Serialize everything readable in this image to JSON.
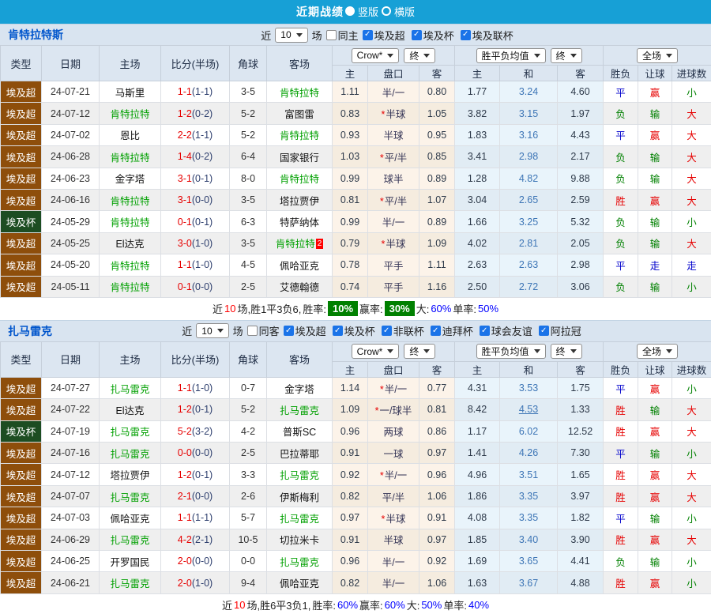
{
  "colors": {
    "accent_blue": "#17a0d6",
    "type_brown": "#8e4e0b",
    "cup_green": "#1d4d22",
    "team_green": "#00a000",
    "win_red": "#e60000",
    "lose_green": "#008000",
    "draw_blue": "#0000cc",
    "badge_green": "#008000",
    "summary_blue": "#0000ff",
    "orange": "#e06c00"
  },
  "topbar": {
    "title": "近期战绩",
    "options": [
      {
        "label": "竖版",
        "selected": true
      },
      {
        "label": "横版",
        "selected": false
      }
    ]
  },
  "table_header": {
    "cols": [
      "类型",
      "日期",
      "主场",
      "比分(半场)",
      "角球",
      "客场"
    ],
    "sub": [
      "主",
      "盘口",
      "客",
      "主",
      "和",
      "客",
      "胜负",
      "让球",
      "进球数"
    ],
    "selects": {
      "crow": "Crow*",
      "end1": "终",
      "avg": "胜平负均值",
      "end2": "终",
      "scope": "全场"
    }
  },
  "sections": [
    {
      "team": "肯特拉特斯",
      "controls": {
        "near": "近",
        "count": "10",
        "unit": "场",
        "same": {
          "label": "同主",
          "checked": false
        },
        "leagues": [
          {
            "label": "埃及超",
            "checked": true
          },
          {
            "label": "埃及杯",
            "checked": true
          },
          {
            "label": "埃及联杯",
            "checked": true
          }
        ]
      },
      "rows": [
        {
          "type": "埃及超",
          "cup": false,
          "date": "24-07-21",
          "home": "马斯里",
          "home_green": false,
          "score": "1-1",
          "half": "(1-1)",
          "corner": "3-5",
          "away": "肯特拉特",
          "away_green": true,
          "away_badge": "",
          "odds_home": "1.11",
          "handicap": "半/一",
          "handicap_star": false,
          "odds_away": "0.80",
          "avg_home": "1.77",
          "avg_draw": "3.24",
          "avg_draw_orange": false,
          "avg_away": "4.60",
          "result": "平",
          "result_color": "blue",
          "handicap_result": "赢",
          "handicap_result_color": "red",
          "goals": "小",
          "goals_color": "green"
        },
        {
          "type": "埃及超",
          "cup": false,
          "date": "24-07-12",
          "home": "肯特拉特",
          "home_green": true,
          "score": "1-2",
          "half": "(0-2)",
          "corner": "5-2",
          "away": "富图雷",
          "away_green": false,
          "away_badge": "",
          "odds_home": "0.83",
          "handicap": "半球",
          "handicap_star": true,
          "odds_away": "1.05",
          "avg_home": "3.82",
          "avg_draw": "3.15",
          "avg_draw_orange": false,
          "avg_away": "1.97",
          "result": "负",
          "result_color": "green",
          "handicap_result": "输",
          "handicap_result_color": "green",
          "goals": "大",
          "goals_color": "red"
        },
        {
          "type": "埃及超",
          "cup": false,
          "date": "24-07-02",
          "home": "恩比",
          "home_green": false,
          "score": "2-2",
          "half": "(1-1)",
          "corner": "5-2",
          "away": "肯特拉特",
          "away_green": true,
          "away_badge": "",
          "odds_home": "0.93",
          "handicap": "半球",
          "handicap_star": false,
          "odds_away": "0.95",
          "avg_home": "1.83",
          "avg_draw": "3.16",
          "avg_draw_orange": false,
          "avg_away": "4.43",
          "result": "平",
          "result_color": "blue",
          "handicap_result": "赢",
          "handicap_result_color": "red",
          "goals": "大",
          "goals_color": "red"
        },
        {
          "type": "埃及超",
          "cup": false,
          "date": "24-06-28",
          "home": "肯特拉特",
          "home_green": true,
          "score": "1-4",
          "half": "(0-2)",
          "corner": "6-4",
          "away": "国家银行",
          "away_green": false,
          "away_badge": "",
          "odds_home": "1.03",
          "handicap": "平/半",
          "handicap_star": true,
          "odds_away": "0.85",
          "avg_home": "3.41",
          "avg_draw": "2.98",
          "avg_draw_orange": false,
          "avg_away": "2.17",
          "result": "负",
          "result_color": "green",
          "handicap_result": "输",
          "handicap_result_color": "green",
          "goals": "大",
          "goals_color": "red"
        },
        {
          "type": "埃及超",
          "cup": false,
          "date": "24-06-23",
          "home": "金字塔",
          "home_green": false,
          "score": "3-1",
          "half": "(0-1)",
          "corner": "8-0",
          "away": "肯特拉特",
          "away_green": true,
          "away_badge": "",
          "odds_home": "0.99",
          "handicap": "球半",
          "handicap_star": false,
          "odds_away": "0.89",
          "avg_home": "1.28",
          "avg_draw": "4.82",
          "avg_draw_orange": false,
          "avg_away": "9.88",
          "result": "负",
          "result_color": "green",
          "handicap_result": "输",
          "handicap_result_color": "green",
          "goals": "大",
          "goals_color": "red"
        },
        {
          "type": "埃及超",
          "cup": false,
          "date": "24-06-16",
          "home": "肯特拉特",
          "home_green": true,
          "score": "3-1",
          "half": "(0-0)",
          "corner": "3-5",
          "away": "塔拉贾伊",
          "away_green": false,
          "away_badge": "",
          "odds_home": "0.81",
          "handicap": "平/半",
          "handicap_star": true,
          "odds_away": "1.07",
          "avg_home": "3.04",
          "avg_draw": "2.65",
          "avg_draw_orange": false,
          "avg_away": "2.59",
          "result": "胜",
          "result_color": "red",
          "handicap_result": "赢",
          "handicap_result_color": "red",
          "goals": "大",
          "goals_color": "red"
        },
        {
          "type": "埃及杯",
          "cup": true,
          "date": "24-05-29",
          "home": "肯特拉特",
          "home_green": true,
          "score": "0-1",
          "half": "(0-1)",
          "corner": "6-3",
          "away": "特萨纳体",
          "away_green": false,
          "away_badge": "",
          "odds_home": "0.99",
          "handicap": "半/一",
          "handicap_star": false,
          "odds_away": "0.89",
          "avg_home": "1.66",
          "avg_draw": "3.25",
          "avg_draw_orange": false,
          "avg_away": "5.32",
          "result": "负",
          "result_color": "green",
          "handicap_result": "输",
          "handicap_result_color": "green",
          "goals": "小",
          "goals_color": "green"
        },
        {
          "type": "埃及超",
          "cup": false,
          "date": "24-05-25",
          "home": "El达克",
          "home_green": false,
          "score": "3-0",
          "half": "(1-0)",
          "corner": "3-5",
          "away": "肯特拉特",
          "away_green": true,
          "away_badge": "2",
          "odds_home": "0.79",
          "handicap": "半球",
          "handicap_star": true,
          "odds_away": "1.09",
          "avg_home": "4.02",
          "avg_draw": "2.81",
          "avg_draw_orange": false,
          "avg_away": "2.05",
          "result": "负",
          "result_color": "green",
          "handicap_result": "输",
          "handicap_result_color": "green",
          "goals": "大",
          "goals_color": "red"
        },
        {
          "type": "埃及超",
          "cup": false,
          "date": "24-05-20",
          "home": "肯特拉特",
          "home_green": true,
          "score": "1-1",
          "half": "(1-0)",
          "corner": "4-5",
          "away": "佩哈亚克",
          "away_green": false,
          "away_badge": "",
          "odds_home": "0.78",
          "handicap": "平手",
          "handicap_star": false,
          "odds_away": "1.11",
          "avg_home": "2.63",
          "avg_draw": "2.63",
          "avg_draw_orange": false,
          "avg_away": "2.98",
          "result": "平",
          "result_color": "blue",
          "handicap_result": "走",
          "handicap_result_color": "blue",
          "goals": "走",
          "goals_color": "blue"
        },
        {
          "type": "埃及超",
          "cup": false,
          "date": "24-05-11",
          "home": "肯特拉特",
          "home_green": true,
          "score": "0-1",
          "half": "(0-0)",
          "corner": "2-5",
          "away": "艾德翰德",
          "away_green": false,
          "away_badge": "",
          "odds_home": "0.74",
          "handicap": "平手",
          "handicap_star": false,
          "odds_away": "1.16",
          "avg_home": "2.50",
          "avg_draw": "2.72",
          "avg_draw_orange": false,
          "avg_away": "3.06",
          "result": "负",
          "result_color": "green",
          "handicap_result": "输",
          "handicap_result_color": "green",
          "goals": "小",
          "goals_color": "green"
        }
      ],
      "summary": {
        "near": "近",
        "count": "10",
        "tail": "场,胜1平3负6,",
        "stats": [
          {
            "label": "胜率:",
            "value": "10%",
            "badge": true
          },
          {
            "label": "赢率:",
            "value": "30%",
            "badge": true
          },
          {
            "label": "大:",
            "value": "60%",
            "badge": false
          },
          {
            "label": "单率:",
            "value": "50%",
            "badge": false
          }
        ]
      }
    },
    {
      "team": "扎马雷克",
      "controls": {
        "near": "近",
        "count": "10",
        "unit": "场",
        "same": {
          "label": "同客",
          "checked": false
        },
        "leagues": [
          {
            "label": "埃及超",
            "checked": true
          },
          {
            "label": "埃及杯",
            "checked": true
          },
          {
            "label": "非联杯",
            "checked": true
          },
          {
            "label": "迪拜杯",
            "checked": true
          },
          {
            "label": "球会友谊",
            "checked": true
          },
          {
            "label": "阿拉冠",
            "checked": true
          }
        ]
      },
      "rows": [
        {
          "type": "埃及超",
          "cup": false,
          "date": "24-07-27",
          "home": "扎马雷克",
          "home_green": true,
          "score": "1-1",
          "half": "(1-0)",
          "corner": "0-7",
          "away": "金字塔",
          "away_green": false,
          "away_badge": "",
          "odds_home": "1.14",
          "handicap": "半/一",
          "handicap_star": true,
          "odds_away": "0.77",
          "avg_home": "4.31",
          "avg_draw": "3.53",
          "avg_draw_orange": false,
          "avg_away": "1.75",
          "result": "平",
          "result_color": "blue",
          "handicap_result": "赢",
          "handicap_result_color": "red",
          "goals": "小",
          "goals_color": "green"
        },
        {
          "type": "埃及超",
          "cup": false,
          "date": "24-07-22",
          "home": "El达克",
          "home_green": false,
          "score": "1-2",
          "half": "(0-1)",
          "corner": "5-2",
          "away": "扎马雷克",
          "away_green": true,
          "away_badge": "",
          "odds_home": "1.09",
          "handicap": "一/球半",
          "handicap_star": true,
          "odds_away": "0.81",
          "avg_home": "8.42",
          "avg_draw": "4.53",
          "avg_draw_orange": true,
          "avg_away": "1.33",
          "result": "胜",
          "result_color": "red",
          "handicap_result": "输",
          "handicap_result_color": "green",
          "goals": "大",
          "goals_color": "red"
        },
        {
          "type": "埃及杯",
          "cup": true,
          "date": "24-07-19",
          "home": "扎马雷克",
          "home_green": true,
          "score": "5-2",
          "half": "(3-2)",
          "corner": "4-2",
          "away": "普斯SC",
          "away_green": false,
          "away_badge": "",
          "odds_home": "0.96",
          "handicap": "两球",
          "handicap_star": false,
          "odds_away": "0.86",
          "avg_home": "1.17",
          "avg_draw": "6.02",
          "avg_draw_orange": false,
          "avg_away": "12.52",
          "result": "胜",
          "result_color": "red",
          "handicap_result": "赢",
          "handicap_result_color": "red",
          "goals": "大",
          "goals_color": "red"
        },
        {
          "type": "埃及超",
          "cup": false,
          "date": "24-07-16",
          "home": "扎马雷克",
          "home_green": true,
          "score": "0-0",
          "half": "(0-0)",
          "corner": "2-5",
          "away": "巴拉蒂耶",
          "away_green": false,
          "away_badge": "",
          "odds_home": "0.91",
          "handicap": "一球",
          "handicap_star": false,
          "odds_away": "0.97",
          "avg_home": "1.41",
          "avg_draw": "4.26",
          "avg_draw_orange": false,
          "avg_away": "7.30",
          "result": "平",
          "result_color": "blue",
          "handicap_result": "输",
          "handicap_result_color": "green",
          "goals": "小",
          "goals_color": "green"
        },
        {
          "type": "埃及超",
          "cup": false,
          "date": "24-07-12",
          "home": "塔拉贾伊",
          "home_green": false,
          "score": "1-2",
          "half": "(0-1)",
          "corner": "3-3",
          "away": "扎马雷克",
          "away_green": true,
          "away_badge": "",
          "odds_home": "0.92",
          "handicap": "半/一",
          "handicap_star": true,
          "odds_away": "0.96",
          "avg_home": "4.96",
          "avg_draw": "3.51",
          "avg_draw_orange": false,
          "avg_away": "1.65",
          "result": "胜",
          "result_color": "red",
          "handicap_result": "赢",
          "handicap_result_color": "red",
          "goals": "大",
          "goals_color": "red"
        },
        {
          "type": "埃及超",
          "cup": false,
          "date": "24-07-07",
          "home": "扎马雷克",
          "home_green": true,
          "score": "2-1",
          "half": "(0-0)",
          "corner": "2-6",
          "away": "伊斯梅利",
          "away_green": false,
          "away_badge": "",
          "odds_home": "0.82",
          "handicap": "平/半",
          "handicap_star": false,
          "odds_away": "1.06",
          "avg_home": "1.86",
          "avg_draw": "3.35",
          "avg_draw_orange": false,
          "avg_away": "3.97",
          "result": "胜",
          "result_color": "red",
          "handicap_result": "赢",
          "handicap_result_color": "red",
          "goals": "大",
          "goals_color": "red"
        },
        {
          "type": "埃及超",
          "cup": false,
          "date": "24-07-03",
          "home": "佩哈亚克",
          "home_green": false,
          "score": "1-1",
          "half": "(1-1)",
          "corner": "5-7",
          "away": "扎马雷克",
          "away_green": true,
          "away_badge": "",
          "odds_home": "0.97",
          "handicap": "半球",
          "handicap_star": true,
          "odds_away": "0.91",
          "avg_home": "4.08",
          "avg_draw": "3.35",
          "avg_draw_orange": false,
          "avg_away": "1.82",
          "result": "平",
          "result_color": "blue",
          "handicap_result": "输",
          "handicap_result_color": "green",
          "goals": "小",
          "goals_color": "green"
        },
        {
          "type": "埃及超",
          "cup": false,
          "date": "24-06-29",
          "home": "扎马雷克",
          "home_green": true,
          "score": "4-2",
          "half": "(2-1)",
          "corner": "10-5",
          "away": "切拉米卡",
          "away_green": false,
          "away_badge": "",
          "odds_home": "0.91",
          "handicap": "半球",
          "handicap_star": false,
          "odds_away": "0.97",
          "avg_home": "1.85",
          "avg_draw": "3.40",
          "avg_draw_orange": false,
          "avg_away": "3.90",
          "result": "胜",
          "result_color": "red",
          "handicap_result": "赢",
          "handicap_result_color": "red",
          "goals": "大",
          "goals_color": "red"
        },
        {
          "type": "埃及超",
          "cup": false,
          "date": "24-06-25",
          "home": "开罗国民",
          "home_green": false,
          "score": "2-0",
          "half": "(0-0)",
          "corner": "0-0",
          "away": "扎马雷克",
          "away_green": true,
          "away_badge": "",
          "odds_home": "0.96",
          "handicap": "半/一",
          "handicap_star": false,
          "odds_away": "0.92",
          "avg_home": "1.69",
          "avg_draw": "3.65",
          "avg_draw_orange": false,
          "avg_away": "4.41",
          "result": "负",
          "result_color": "green",
          "handicap_result": "输",
          "handicap_result_color": "green",
          "goals": "小",
          "goals_color": "green"
        },
        {
          "type": "埃及超",
          "cup": false,
          "date": "24-06-21",
          "home": "扎马雷克",
          "home_green": true,
          "score": "2-0",
          "half": "(1-0)",
          "corner": "9-4",
          "away": "佩哈亚克",
          "away_green": false,
          "away_badge": "",
          "odds_home": "0.82",
          "handicap": "半/一",
          "handicap_star": false,
          "odds_away": "1.06",
          "avg_home": "1.63",
          "avg_draw": "3.67",
          "avg_draw_orange": false,
          "avg_away": "4.88",
          "result": "胜",
          "result_color": "red",
          "handicap_result": "赢",
          "handicap_result_color": "red",
          "goals": "小",
          "goals_color": "green"
        }
      ],
      "summary": {
        "near": "近",
        "count": "10",
        "tail": "场,胜6平3负1,",
        "stats": [
          {
            "label": "胜率:",
            "value": "60%",
            "badge": false
          },
          {
            "label": "赢率:",
            "value": "60%",
            "badge": false
          },
          {
            "label": "大:",
            "value": "50%",
            "badge": false
          },
          {
            "label": "单率:",
            "value": "40%",
            "badge": false
          }
        ]
      }
    }
  ]
}
